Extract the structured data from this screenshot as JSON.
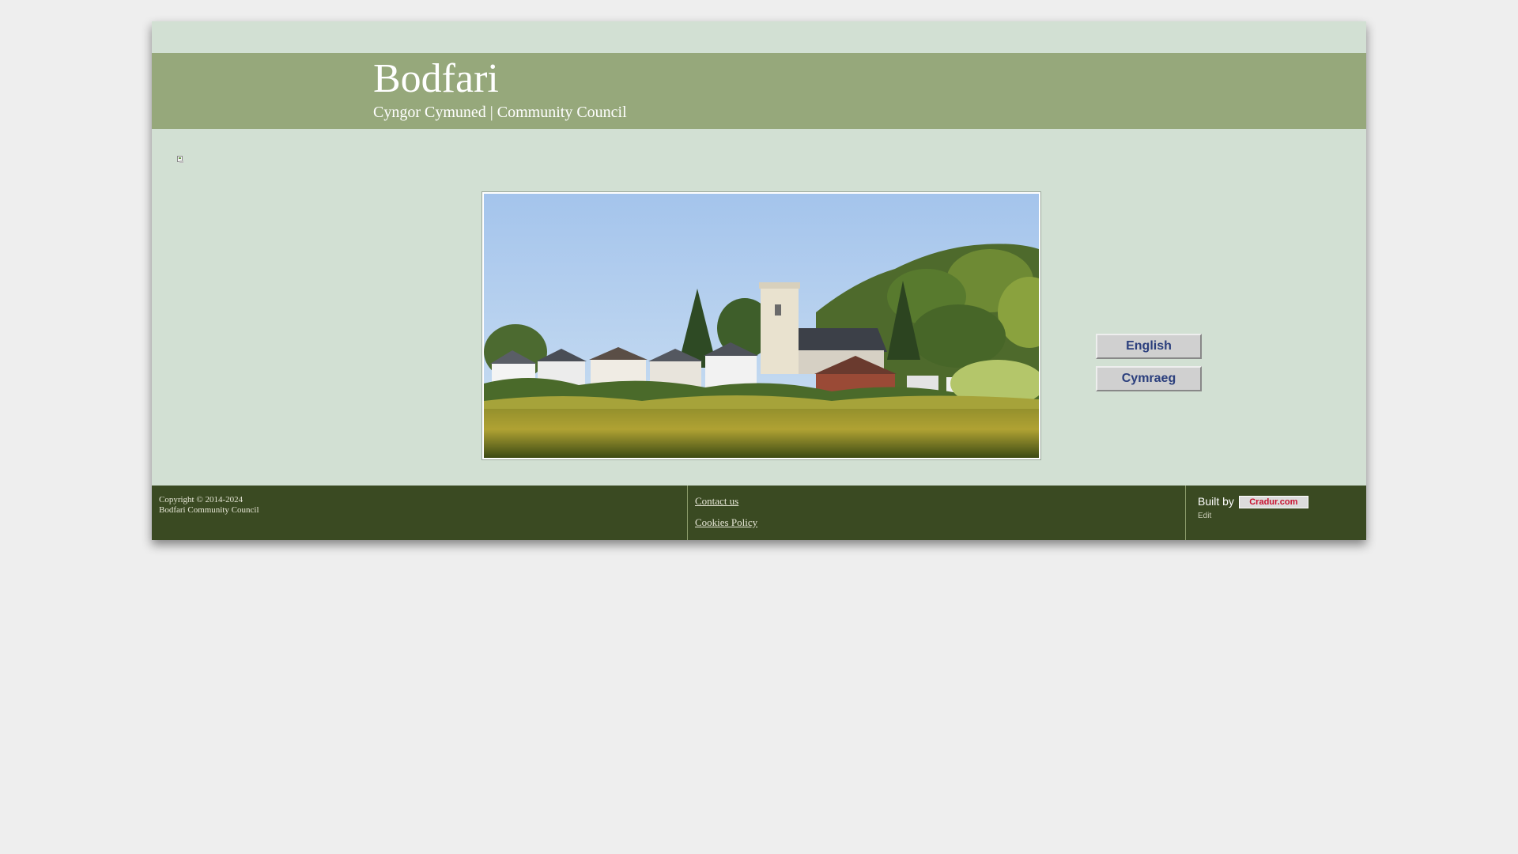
{
  "header": {
    "title": "Bodfari",
    "subtitle": "Cyngor Cymuned | Community Council"
  },
  "content": {
    "banner_image": "village-church-landscape",
    "broken_image_icon": "broken-image-icon"
  },
  "language_buttons": {
    "english": "English",
    "welsh": "Cymraeg"
  },
  "footer": {
    "copyright_line1": "Copyright © 2014-2024",
    "copyright_line2": "Bodfari Community Council",
    "links": [
      "Contact us",
      "Cookies Policy"
    ],
    "built_by_label": "Built by",
    "builder_name": "Cradur.com",
    "edit_label": "Edit"
  },
  "colors": {
    "page_background": "#eeeeee",
    "frame_background": "#d2e0d3",
    "header_background": "#96a87b",
    "footer_background": "#3a4a22",
    "button_text": "#2b3f7d",
    "badge_text": "#c8102e"
  }
}
